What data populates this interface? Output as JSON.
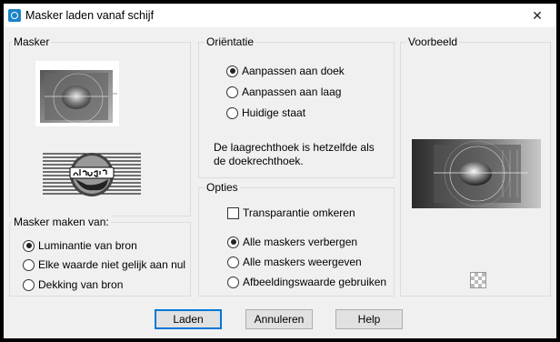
{
  "window": {
    "title": "Masker laden vanaf schijf",
    "close_symbol": "✕"
  },
  "masker": {
    "legend": "Masker"
  },
  "masker_source": {
    "legend": "Masker maken van:",
    "options": [
      {
        "label": "Luminantie van bron",
        "selected": true
      },
      {
        "label": "Elke waarde niet gelijk aan nul",
        "selected": false
      },
      {
        "label": "Dekking van bron",
        "selected": false
      }
    ]
  },
  "orientation": {
    "legend": "Oriëntatie",
    "options": [
      {
        "label": "Aanpassen aan doek",
        "selected": true
      },
      {
        "label": "Aanpassen aan laag",
        "selected": false
      },
      {
        "label": "Huidige staat",
        "selected": false
      }
    ],
    "note": "De laagrechthoek is hetzelfde als de doekrechthoek."
  },
  "options": {
    "legend": "Opties",
    "invert_label": "Transparantie omkeren",
    "invert_checked": false,
    "visibility": [
      {
        "label": "Alle maskers verbergen",
        "selected": true
      },
      {
        "label": "Alle maskers weergeven",
        "selected": false
      },
      {
        "label": "Afbeeldingswaarde gebruiken",
        "selected": false
      }
    ]
  },
  "preview": {
    "legend": "Voorbeeld"
  },
  "buttons": {
    "ok": "Laden",
    "cancel": "Annuleren",
    "help": "Help"
  }
}
